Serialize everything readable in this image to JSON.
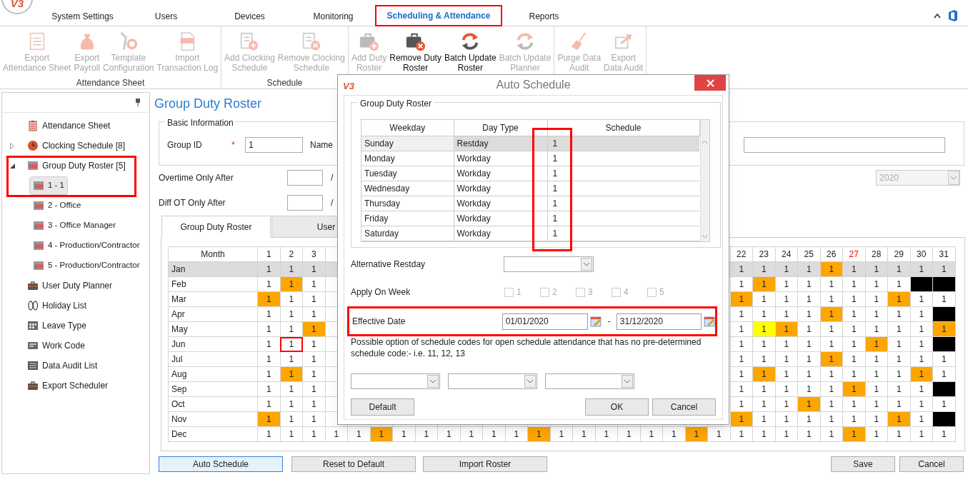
{
  "app": {
    "logo": "V3",
    "tabs": [
      {
        "label": "System Settings",
        "selected": false,
        "annotated": false
      },
      {
        "label": "Users",
        "selected": false,
        "annotated": false
      },
      {
        "label": "Devices",
        "selected": false,
        "annotated": false
      },
      {
        "label": "Monitoring",
        "selected": false,
        "annotated": false
      },
      {
        "label": "Scheduling & Attendance",
        "selected": true,
        "annotated": true
      },
      {
        "label": "Reports",
        "selected": false,
        "annotated": false
      }
    ]
  },
  "ribbon": {
    "groups": [
      {
        "label": "Attendance Sheet",
        "buttons": [
          {
            "label": "Export\nAttendance Sheet",
            "disabled": true
          },
          {
            "label": "Export\nPayroll",
            "disabled": true
          },
          {
            "label": "Template\nConfiguration",
            "disabled": true
          },
          {
            "label": "Import\nTransaction Log",
            "disabled": true
          }
        ]
      },
      {
        "label": "Schedule",
        "buttons": [
          {
            "label": "Add Clocking\nSchedule",
            "disabled": true
          },
          {
            "label": "Remove Clocking\nSchedule",
            "disabled": true
          }
        ]
      },
      {
        "buttons": [
          {
            "label": "Add Duty\nRoster",
            "disabled": true
          },
          {
            "label": "Remove Duty\nRoster",
            "disabled": false
          },
          {
            "label": "Batch Update\nRoster",
            "disabled": false
          },
          {
            "label": "Batch Update\nPlanner",
            "disabled": true
          }
        ]
      },
      {
        "buttons": [
          {
            "label": "Purge Data\nAudit",
            "disabled": true
          },
          {
            "label": "Export\nData Audit",
            "disabled": true
          }
        ]
      }
    ]
  },
  "sidebar": {
    "items": [
      {
        "label": "Attendance Sheet",
        "selected": false,
        "annotated": false
      },
      {
        "label": "Clocking Schedule [8]",
        "selected": false,
        "expanded": false,
        "annotated": false
      },
      {
        "label": "Group Duty Roster [5]",
        "selected": false,
        "expanded": true,
        "annotated": true,
        "children": [
          {
            "label": "1 - 1",
            "selected": true
          },
          {
            "label": "2 - Office",
            "selected": false
          },
          {
            "label": "3 - Office Manager",
            "selected": false
          },
          {
            "label": "4 - Production/Contractor",
            "selected": false
          },
          {
            "label": "5 - Production/Contractor",
            "selected": false
          }
        ]
      },
      {
        "label": "User Duty Planner",
        "selected": false,
        "annotated": false
      },
      {
        "label": "Holiday List",
        "selected": false,
        "annotated": false
      },
      {
        "label": "Leave Type",
        "selected": false,
        "annotated": false
      },
      {
        "label": "Work Code",
        "selected": false,
        "annotated": false
      },
      {
        "label": "Data Audit List",
        "selected": false,
        "annotated": false
      },
      {
        "label": "Export Scheduler",
        "selected": false,
        "annotated": false
      }
    ]
  },
  "main": {
    "title": "Group Duty Roster",
    "basic_information": {
      "legend": "Basic Information",
      "group_id_label": "Group ID",
      "required_mark": "*",
      "group_id_value": "1",
      "name_label": "Name"
    },
    "overtime_label": "Overtime Only After",
    "overtime_separator": "/",
    "year_value": "2020",
    "year_disabled": true,
    "diff_ot_label": "Diff OT Only After",
    "diff_ot_separator": "/",
    "tabs": [
      {
        "label": "Group Duty Roster",
        "selected": true
      },
      {
        "label": "User",
        "selected": false
      }
    ],
    "roster_grid": {
      "month_heading": "Month",
      "days_start": [
        {
          "text": "1",
          "holiday": false
        },
        {
          "text": "2",
          "holiday": false
        },
        {
          "text": "3",
          "holiday": false
        }
      ],
      "days_end": [
        {
          "text": "22",
          "holiday": false
        },
        {
          "text": "23",
          "holiday": false
        },
        {
          "text": "24",
          "holiday": false
        },
        {
          "text": "25",
          "holiday": false
        },
        {
          "text": "26",
          "holiday": false
        },
        {
          "text": "27",
          "holiday": true
        },
        {
          "text": "28",
          "holiday": false
        },
        {
          "text": "29",
          "holiday": false
        },
        {
          "text": "30",
          "holiday": false
        },
        {
          "text": "31",
          "holiday": false
        }
      ],
      "rows": [
        {
          "month": "Jan",
          "selected": true,
          "cells_start": [
            {
              "text": "1"
            },
            {
              "text": "1"
            },
            {
              "text": "1"
            }
          ],
          "cells_end": [
            {
              "text": "1"
            },
            {
              "text": "1"
            },
            {
              "text": "1"
            },
            {
              "text": "1"
            },
            {
              "text": "1",
              "color": "#ffa500"
            },
            {
              "text": "1"
            },
            {
              "text": "1"
            },
            {
              "text": "1"
            },
            {
              "text": "1"
            },
            {
              "text": "1"
            }
          ]
        },
        {
          "month": "Feb",
          "selected": false,
          "cells_start": [
            {
              "text": "1"
            },
            {
              "text": "1",
              "color": "#ffa500"
            },
            {
              "text": "1"
            }
          ],
          "cells_end": [
            {
              "text": "1"
            },
            {
              "text": "1",
              "color": "#ffa500"
            },
            {
              "text": "1"
            },
            {
              "text": "1"
            },
            {
              "text": "1"
            },
            {
              "text": "1"
            },
            {
              "text": "1"
            },
            {
              "text": "1"
            },
            {
              "color": "#000000"
            },
            {
              "color": "#000000"
            }
          ]
        },
        {
          "month": "Mar",
          "selected": false,
          "cells_start": [
            {
              "text": "1",
              "color": "#ffa500"
            },
            {
              "text": "1"
            },
            {
              "text": "1"
            }
          ],
          "cells_end": [
            {
              "text": "1",
              "color": "#ffa500"
            },
            {
              "text": "1"
            },
            {
              "text": "1"
            },
            {
              "text": "1"
            },
            {
              "text": "1"
            },
            {
              "text": "1"
            },
            {
              "text": "1"
            },
            {
              "text": "1",
              "color": "#ffa500"
            },
            {
              "text": "1"
            },
            {
              "text": "1"
            }
          ]
        },
        {
          "month": "Apr",
          "selected": false,
          "cells_start": [
            {
              "text": "1"
            },
            {
              "text": "1"
            },
            {
              "text": "1"
            }
          ],
          "cells_end": [
            {
              "text": "1"
            },
            {
              "text": "1"
            },
            {
              "text": "1"
            },
            {
              "text": "1"
            },
            {
              "text": "1",
              "color": "#ffa500"
            },
            {
              "text": "1"
            },
            {
              "text": "1"
            },
            {
              "text": "1"
            },
            {
              "text": "1"
            },
            {
              "color": "#000000"
            }
          ]
        },
        {
          "month": "May",
          "selected": false,
          "cells_start": [
            {
              "text": "1"
            },
            {
              "text": "1"
            },
            {
              "text": "1",
              "color": "#ffa500"
            }
          ],
          "cells_end": [
            {
              "text": "1"
            },
            {
              "text": "1",
              "color": "#ffff00"
            },
            {
              "text": "1",
              "color": "#ffa500"
            },
            {
              "text": "1"
            },
            {
              "text": "1"
            },
            {
              "text": "1"
            },
            {
              "text": "1"
            },
            {
              "text": "1"
            },
            {
              "text": "1"
            },
            {
              "text": "1",
              "color": "#ffa500"
            }
          ]
        },
        {
          "month": "Jun",
          "selected": false,
          "cells_start": [
            {
              "text": "1"
            },
            {
              "text": "1",
              "annotated": true
            },
            {
              "text": "1"
            }
          ],
          "cells_end": [
            {
              "text": "1"
            },
            {
              "text": "1"
            },
            {
              "text": "1"
            },
            {
              "text": "1"
            },
            {
              "text": "1"
            },
            {
              "text": "1"
            },
            {
              "text": "1",
              "color": "#ffa500"
            },
            {
              "text": "1"
            },
            {
              "text": "1"
            },
            {
              "color": "#000000"
            }
          ]
        },
        {
          "month": "Jul",
          "selected": false,
          "cells_start": [
            {
              "text": "1"
            },
            {
              "text": "1"
            },
            {
              "text": "1"
            }
          ],
          "cells_end": [
            {
              "text": "1"
            },
            {
              "text": "1"
            },
            {
              "text": "1"
            },
            {
              "text": "1"
            },
            {
              "text": "1",
              "color": "#ffa500"
            },
            {
              "text": "1"
            },
            {
              "text": "1"
            },
            {
              "text": "1"
            },
            {
              "text": "1"
            },
            {
              "text": "1"
            }
          ]
        },
        {
          "month": "Aug",
          "selected": false,
          "cells_start": [
            {
              "text": "1"
            },
            {
              "text": "1",
              "color": "#ffa500"
            },
            {
              "text": "1"
            }
          ],
          "cells_end": [
            {
              "text": "1"
            },
            {
              "text": "1",
              "color": "#ffa500"
            },
            {
              "text": "1"
            },
            {
              "text": "1"
            },
            {
              "text": "1"
            },
            {
              "text": "1"
            },
            {
              "text": "1"
            },
            {
              "text": "1"
            },
            {
              "text": "1",
              "color": "#ffa500"
            },
            {
              "text": "1"
            }
          ]
        },
        {
          "month": "Sep",
          "selected": false,
          "cells_start": [
            {
              "text": "1"
            },
            {
              "text": "1"
            },
            {
              "text": "1"
            }
          ],
          "cells_end": [
            {
              "text": "1"
            },
            {
              "text": "1"
            },
            {
              "text": "1"
            },
            {
              "text": "1"
            },
            {
              "text": "1"
            },
            {
              "text": "1",
              "color": "#ffa500"
            },
            {
              "text": "1"
            },
            {
              "text": "1"
            },
            {
              "text": "1"
            },
            {
              "color": "#000000"
            }
          ]
        },
        {
          "month": "Oct",
          "selected": false,
          "cells_start": [
            {
              "text": "1"
            },
            {
              "text": "1"
            },
            {
              "text": "1"
            }
          ],
          "cells_end": [
            {
              "text": "1"
            },
            {
              "text": "1"
            },
            {
              "text": "1"
            },
            {
              "text": "1",
              "color": "#ffa500"
            },
            {
              "text": "1"
            },
            {
              "text": "1"
            },
            {
              "text": "1"
            },
            {
              "text": "1"
            },
            {
              "text": "1"
            },
            {
              "text": "1"
            }
          ]
        },
        {
          "month": "Nov",
          "selected": false,
          "cells_start": [
            {
              "text": "1",
              "color": "#ffa500"
            },
            {
              "text": "1"
            },
            {
              "text": "1"
            }
          ],
          "cells_end": [
            {
              "text": "1",
              "color": "#ffa500"
            },
            {
              "text": "1"
            },
            {
              "text": "1"
            },
            {
              "text": "1"
            },
            {
              "text": "1"
            },
            {
              "text": "1"
            },
            {
              "text": "1"
            },
            {
              "text": "1",
              "color": "#ffa500"
            },
            {
              "text": "1"
            },
            {
              "color": "#000000"
            }
          ]
        },
        {
          "month": "Dec",
          "selected": false,
          "cells_start": [
            {
              "text": "1"
            },
            {
              "text": "1"
            },
            {
              "text": "1"
            },
            {
              "text": "1"
            },
            {
              "text": "1"
            },
            {
              "text": "1",
              "color": "#ffa500"
            },
            {
              "text": "1"
            },
            {
              "text": "1"
            },
            {
              "text": "1"
            },
            {
              "text": "1"
            },
            {
              "text": "1"
            },
            {
              "text": "1"
            },
            {
              "text": "1",
              "color": "#ffa500"
            },
            {
              "text": "1"
            },
            {
              "text": "1"
            },
            {
              "text": "1"
            },
            {
              "text": "1"
            },
            {
              "text": "1"
            },
            {
              "text": "1"
            },
            {
              "text": "1",
              "color": "#ffa500"
            },
            {
              "text": "1"
            },
            {
              "text": "1"
            },
            {
              "text": "1"
            },
            {
              "text": "1"
            },
            {
              "text": "1"
            },
            {
              "text": "1"
            },
            {
              "text": "1",
              "color": "#ffa500"
            },
            {
              "text": "1"
            },
            {
              "text": "1"
            },
            {
              "text": "1"
            },
            {
              "text": "1"
            }
          ]
        }
      ]
    },
    "buttons": [
      {
        "label": "Auto Schedule",
        "focused": true
      },
      {
        "label": "Reset to Default",
        "focused": false
      },
      {
        "label": "Import Roster",
        "focused": false
      },
      {
        "label": "Save",
        "focused": false
      },
      {
        "label": "Cancel",
        "focused": false
      }
    ]
  },
  "dialog": {
    "logo": "V3",
    "title": "Auto Schedule",
    "roster": {
      "legend": "Group Duty Roster",
      "columns": [
        "Weekday",
        "Day Type",
        "Schedule"
      ],
      "schedule_annotated": true,
      "rows": [
        {
          "weekday": "Sunday",
          "day_type": "Restday",
          "schedule": "1",
          "selected": true
        },
        {
          "weekday": "Monday",
          "day_type": "Workday",
          "schedule": "1",
          "selected": false
        },
        {
          "weekday": "Tuesday",
          "day_type": "Workday",
          "schedule": "1",
          "selected": false
        },
        {
          "weekday": "Wednesday",
          "day_type": "Workday",
          "schedule": "1",
          "selected": false
        },
        {
          "weekday": "Thursday",
          "day_type": "Workday",
          "schedule": "1",
          "selected": false
        },
        {
          "weekday": "Friday",
          "day_type": "Workday",
          "schedule": "1",
          "selected": false
        },
        {
          "weekday": "Saturday",
          "day_type": "Workday",
          "schedule": "1",
          "selected": false
        }
      ]
    },
    "alternative_restday_label": "Alternative Restday",
    "apply_on_week": {
      "label": "Apply On Week",
      "options": [
        {
          "label": "1",
          "checked": false,
          "disabled": true
        },
        {
          "label": "2",
          "checked": false,
          "disabled": true
        },
        {
          "label": "3",
          "checked": false,
          "disabled": true
        },
        {
          "label": "4",
          "checked": false,
          "disabled": true
        },
        {
          "label": "5",
          "checked": false,
          "disabled": true
        }
      ]
    },
    "effective_date": {
      "label": "Effective Date",
      "from": "01/01/2020",
      "separator": "-",
      "to": "31/12/2020",
      "annotated": true
    },
    "note": "Possible option of schedule codes for open schedule attendance that has no pre-determined schedule code:- i.e. 11, 12, 13",
    "buttons": [
      {
        "label": "Default"
      },
      {
        "label": "OK"
      },
      {
        "label": "Cancel"
      }
    ]
  }
}
